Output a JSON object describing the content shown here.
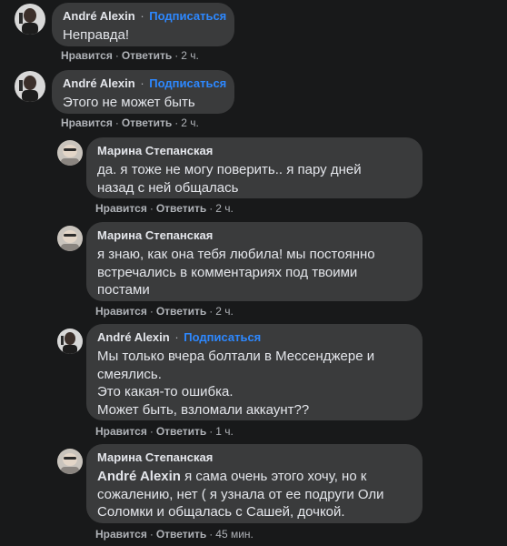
{
  "follow_label": "Подписаться",
  "like_label": "Нравится",
  "reply_label": "Ответить",
  "comments": [
    {
      "author": "André Alexin",
      "show_follow": true,
      "lines": [
        "Неправда!"
      ],
      "time": "2 ч."
    },
    {
      "author": "André Alexin",
      "show_follow": true,
      "lines": [
        "Этого не может быть"
      ],
      "time": "2 ч."
    },
    {
      "author": "Марина Степанская",
      "show_follow": false,
      "lines": [
        "да. я тоже не могу поверить.. я пару дней",
        "назад с ней общалась"
      ],
      "time": "2 ч."
    },
    {
      "author": "Марина Степанская",
      "show_follow": false,
      "lines": [
        "я знаю, как она тебя любила! мы постоянно",
        "встречались в комментариях под твоими",
        "постами"
      ],
      "time": "2 ч."
    },
    {
      "author": "André Alexin",
      "show_follow": true,
      "lines": [
        "Мы только вчера болтали в Мессенджере и",
        "смеялись.",
        "Это какая-то ошибка.",
        "Может быть, взломали аккаунт??"
      ],
      "time": "1 ч."
    },
    {
      "author": "Марина Степанская",
      "show_follow": false,
      "mention": "André Alexin",
      "lines": [
        " я сама очень этого хочу, но к",
        "сожалению, нет ( я узнала от ее подруги Оли",
        "Соломки и общалась с Сашей, дочкой."
      ],
      "time": "45 мин."
    }
  ]
}
